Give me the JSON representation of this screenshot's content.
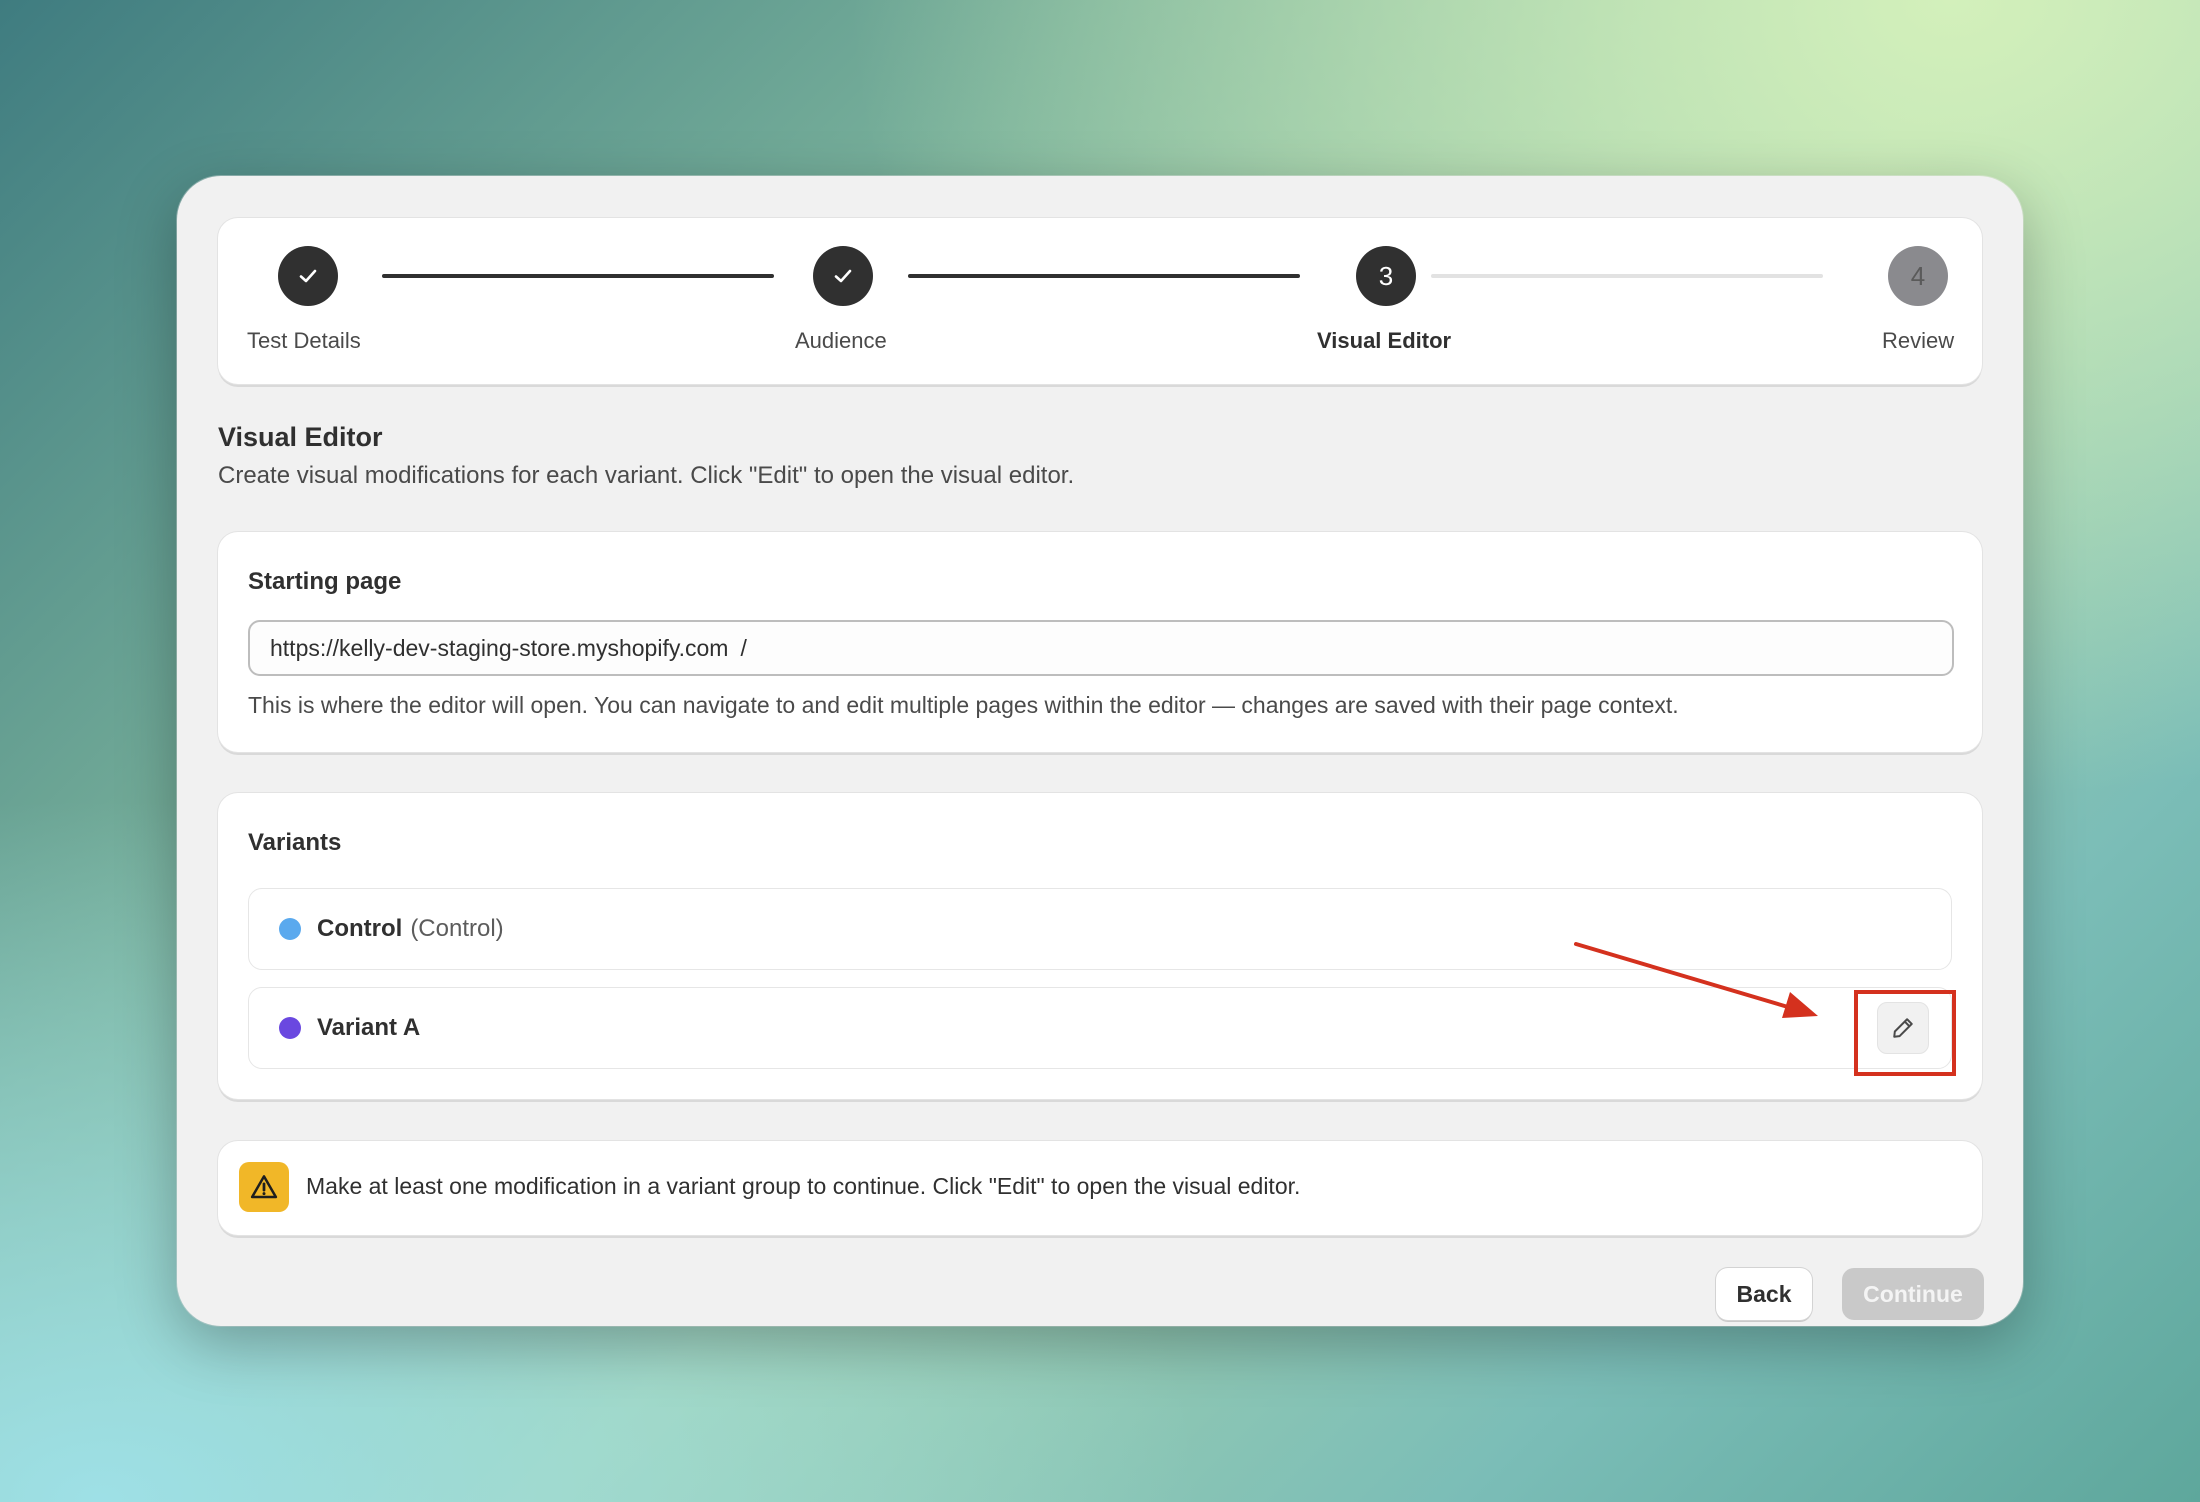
{
  "stepper": {
    "steps": [
      {
        "label": "Test Details",
        "marker": "check-icon",
        "state": "complete"
      },
      {
        "label": "Audience",
        "marker": "check-icon",
        "state": "complete"
      },
      {
        "label": "Visual Editor",
        "marker": "3",
        "state": "active"
      },
      {
        "label": "Review",
        "marker": "4",
        "state": "pending"
      }
    ]
  },
  "section": {
    "title": "Visual Editor",
    "description": "Create visual modifications for each variant. Click \"Edit\" to open the visual editor."
  },
  "starting_page": {
    "heading": "Starting page",
    "url": "https://kelly-dev-staging-store.myshopify.com",
    "path": "/",
    "helper": "This is where the editor will open. You can navigate to and edit multiple pages within the editor — changes are saved with their page context."
  },
  "variants": {
    "heading": "Variants",
    "items": [
      {
        "name": "Control",
        "sub": "(Control)",
        "color": "#5aa9ee"
      },
      {
        "name": "Variant A",
        "sub": "",
        "color": "#6a48e0"
      }
    ],
    "edit_icon": "pencil-icon"
  },
  "warning": {
    "icon": "warning-triangle-icon",
    "text": "Make at least one modification in a variant group to continue. Click \"Edit\" to open the visual editor."
  },
  "footer": {
    "back_label": "Back",
    "continue_label": "Continue"
  },
  "annotation": {
    "color": "#d4311e"
  }
}
